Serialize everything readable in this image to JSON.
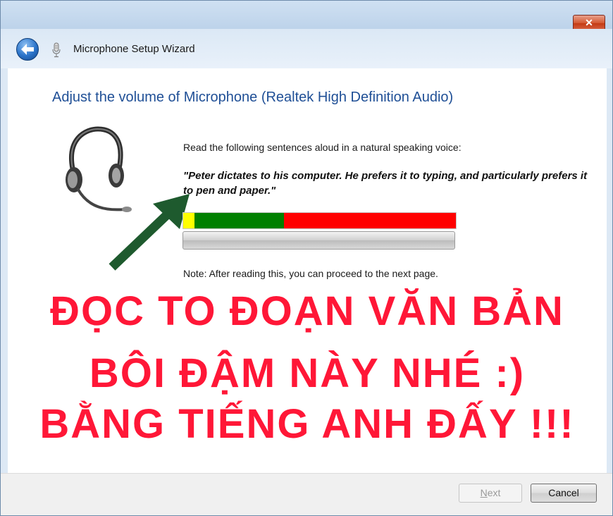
{
  "window": {
    "close_label": "✕",
    "title": "Microphone Setup Wizard"
  },
  "icons": {
    "back": "back-arrow-icon",
    "microphone": "microphone-icon",
    "headset": "headset-icon",
    "annotation_arrow": "annotation-arrow-icon"
  },
  "main": {
    "heading": "Adjust the volume of Microphone (Realtek High Definition Audio)",
    "instruction": "Read the following sentences aloud in a natural speaking voice:",
    "sentence": "\"Peter dictates to his computer. He prefers it to typing, and particularly prefers it to pen and paper.\"",
    "note": "Note: After reading this, you can proceed to the next page.",
    "level_meter": {
      "colors": {
        "low": "#ffff00",
        "ok": "#008000",
        "high": "#ff0000"
      }
    },
    "progress": {
      "value": 0
    }
  },
  "overlay": {
    "line1": "ĐỌC TO ĐOẠN VĂN BẢN",
    "line2": "BÔI ĐẬM NÀY NHÉ :)",
    "line3": "BẰNG TIẾNG ANH ĐẤY !!!",
    "color": "#ff1737"
  },
  "footer": {
    "next_label_underlined": "N",
    "next_label_rest": "ext",
    "cancel_label": "Cancel"
  }
}
